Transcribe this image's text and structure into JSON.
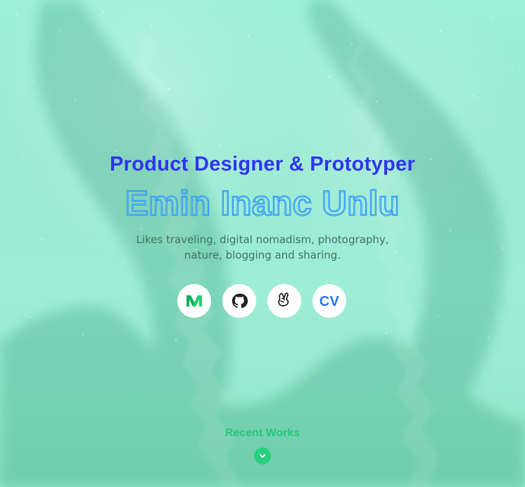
{
  "hero": {
    "subtitle": "Product Designer & Prototyper",
    "name": "Emin Inanc Unlu",
    "bio_line_1": "Likes traveling, digital nomadism, photography,",
    "bio_line_2": "nature, blogging and sharing."
  },
  "social": {
    "medium_icon": "medium-icon",
    "github_icon": "github-icon",
    "angellist_icon": "angellist-icon",
    "cv_label": "CV"
  },
  "footer": {
    "recent_works": "Recent Works",
    "scroll_icon": "chevron-down-icon"
  },
  "colors": {
    "background": "#9eecd4",
    "primary_blue": "#2f34f0",
    "name_blue": "#1e7cff",
    "text_muted": "#3f735f",
    "accent_green": "#27cf7d",
    "white": "#ffffff"
  }
}
